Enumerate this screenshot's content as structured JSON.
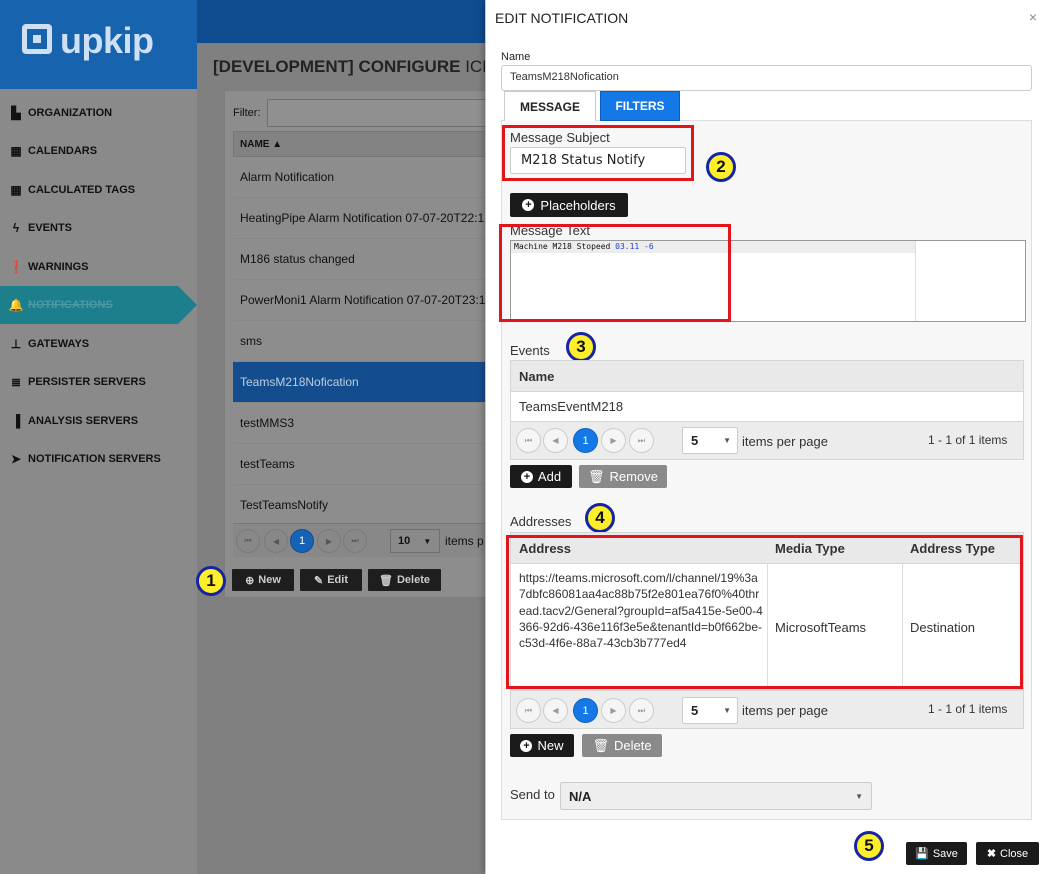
{
  "app": {
    "logo_text": "upkip"
  },
  "sidebar": {
    "items": [
      {
        "label": "ORGANIZATION",
        "icon": "org-chart-icon",
        "glyph": "▙"
      },
      {
        "label": "CALENDARS",
        "icon": "calendar-icon",
        "glyph": "▦"
      },
      {
        "label": "CALCULATED TAGS",
        "icon": "calculator-icon",
        "glyph": "▦"
      },
      {
        "label": "EVENTS",
        "icon": "bolt-icon",
        "glyph": "ϟ"
      },
      {
        "label": "WARNINGS",
        "icon": "warning-icon",
        "glyph": "❗"
      },
      {
        "label": "NOTIFICATIONS",
        "icon": "bell-icon",
        "glyph": "🔔"
      },
      {
        "label": "GATEWAYS",
        "icon": "sitemap-icon",
        "glyph": "⊥"
      },
      {
        "label": "PERSISTER SERVERS",
        "icon": "server-icon",
        "glyph": "≣"
      },
      {
        "label": "ANALYSIS SERVERS",
        "icon": "bar-chart-icon",
        "glyph": "▐"
      },
      {
        "label": "NOTIFICATION SERVERS",
        "icon": "paper-plane-icon",
        "glyph": "➤"
      }
    ]
  },
  "page": {
    "title_bold": "[DEVELOPMENT] CONFIGURE",
    "title_light": "ICB O",
    "filter_label": "Filter:",
    "grid_header": "NAME ▲",
    "rows": [
      "Alarm Notification",
      "HeatingPipe Alarm Notification 07-07-20T22:1",
      "M186 status changed",
      "PowerMoni1 Alarm Notification 07-07-20T23:1",
      "sms",
      "TeamsM218Nofication",
      "testMMS3",
      "testTeams",
      "TestTeamsNotify"
    ],
    "pager_current": "1",
    "per_page": "10",
    "per_page_label": "items p",
    "new_label": "New",
    "edit_label": "Edit",
    "delete_label": "Delete"
  },
  "modal": {
    "title": "EDIT NOTIFICATION",
    "close_glyph": "×",
    "name_label": "Name",
    "name_value": "TeamsM218Nofication",
    "tab_message": "MESSAGE",
    "tab_filters": "FILTERS",
    "subject_label": "Message Subject",
    "subject_value": "M218 Status Notify",
    "placeholders_label": "Placeholders",
    "message_text_label": "Message Text",
    "message_text_plain": "Machine M218 Stopeed ",
    "message_text_blue": "03.11 -6",
    "events_label": "Events",
    "events_col_name": "Name",
    "events_rows": [
      "TeamsEventM218"
    ],
    "events_pager_current": "1",
    "events_per_page": "5",
    "items_per_page_label": "items per page",
    "events_page_info": "1 - 1 of 1 items",
    "add_label": "Add",
    "remove_label": "Remove",
    "addresses_label": "Addresses",
    "addr_col_address": "Address",
    "addr_col_media": "Media Type",
    "addr_col_type": "Address Type",
    "addr_url": "https://teams.microsoft.com/l/channel/19%3a7dbfc86081aa4ac88b75f2e801ea76f0%40thread.tacv2/General?groupId=af5a415e-5e00-4366-92d6-436e116f3e5e&tenantId=b0f662be-c53d-4f6e-88a7-43cb3b777ed4",
    "addr_media": "MicrosoftTeams",
    "addr_type": "Destination",
    "addr_pager_current": "1",
    "addr_per_page": "5",
    "addr_page_info": "1 - 1 of 1 items",
    "new_label": "New",
    "delete_label": "Delete",
    "send_to_label": "Send to",
    "send_to_value": "N/A",
    "save_label": "Save",
    "close_label": "Close"
  },
  "callouts": [
    "1",
    "2",
    "3",
    "4",
    "5"
  ],
  "colors": {
    "brand_blue": "#1763ad",
    "accent_blue": "#1479e6",
    "highlight_red": "#e2151a",
    "callout_yellow": "#ffef2b"
  }
}
